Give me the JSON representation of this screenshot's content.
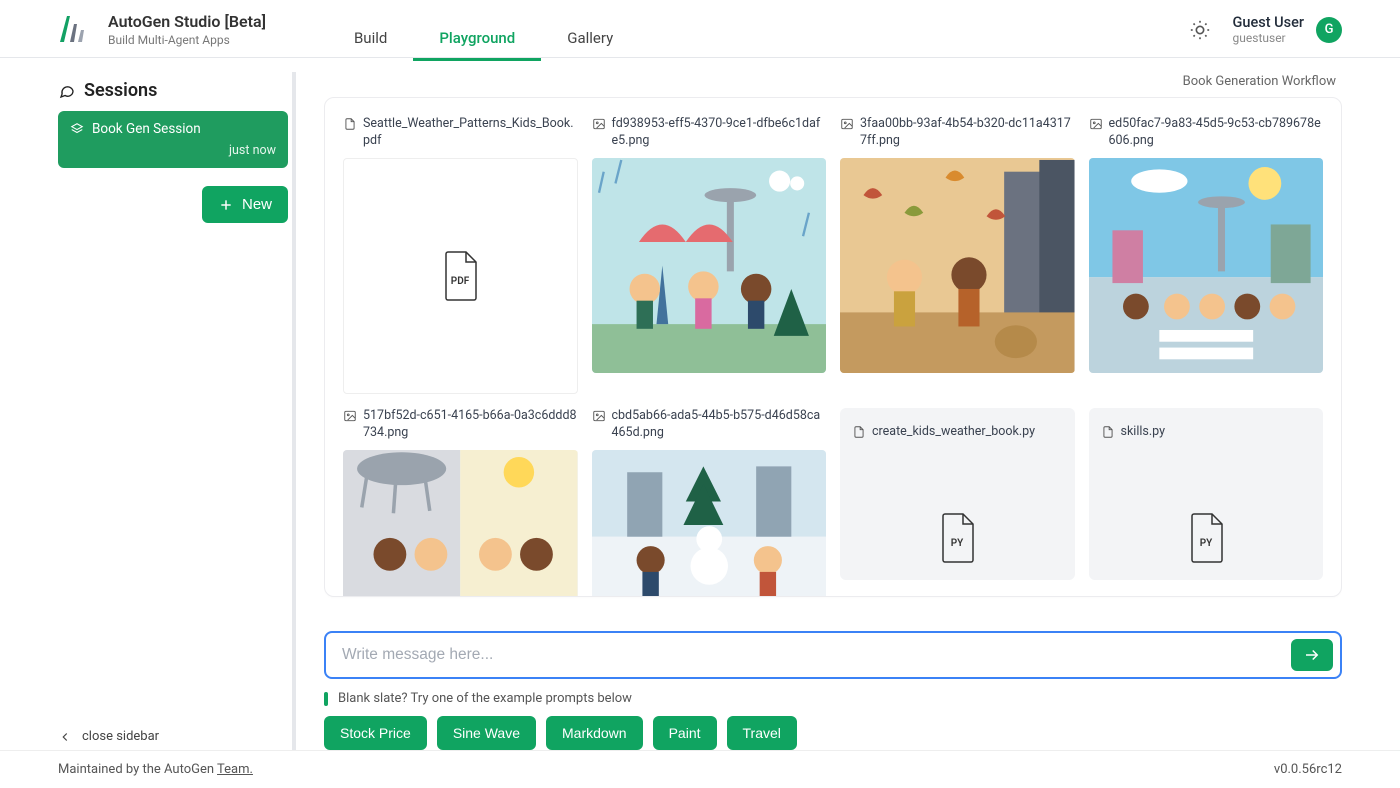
{
  "brand": {
    "title": "AutoGen Studio [Beta]",
    "subtitle": "Build Multi-Agent Apps"
  },
  "tabs": {
    "build": "Build",
    "playground": "Playground",
    "gallery": "Gallery"
  },
  "user": {
    "name": "Guest User",
    "handle": "guestuser",
    "initial": "G"
  },
  "sidebar": {
    "header": "Sessions",
    "session": {
      "name": "Book Gen Session",
      "time": "just now"
    },
    "new_label": "New",
    "close_label": "close sidebar"
  },
  "workflow_label": "Book Generation Workflow",
  "files": {
    "f0": "Seattle_Weather_Patterns_Kids_Book.pdf",
    "f1": "fd938953-eff5-4370-9ce1-dfbe6c1dafe5.png",
    "f2": "3faa00bb-93af-4b54-b320-dc11a43177ff.png",
    "f3": "ed50fac7-9a83-45d5-9c53-cb789678e606.png",
    "f4": "517bf52d-c651-4165-b66a-0a3c6ddd8734.png",
    "f5": "cbd5ab66-ada5-44b5-b575-d46d58ca465d.png",
    "f6": "create_kids_weather_book.py",
    "f7": "skills.py"
  },
  "input": {
    "placeholder": "Write message here..."
  },
  "hint": "Blank slate? Try one of the example prompts below",
  "chips": {
    "c0": "Stock Price",
    "c1": "Sine Wave",
    "c2": "Markdown",
    "c3": "Paint",
    "c4": "Travel"
  },
  "footer": {
    "prefix": "Maintained by the AutoGen ",
    "team": "Team.",
    "version": "v0.0.56rc12"
  }
}
